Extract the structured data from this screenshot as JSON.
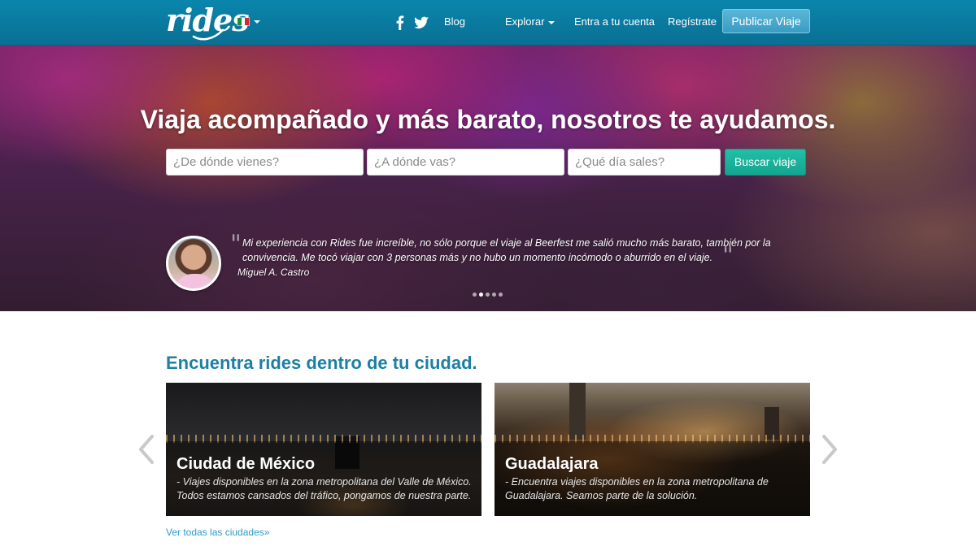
{
  "brand": {
    "logo": "rides"
  },
  "header": {
    "language_flag": "mexico-flag-icon",
    "blog_label": "Blog",
    "explore_label": "Explorar",
    "login_label": "Entra a tu cuenta",
    "register_label": "Regístrate",
    "publish_label": "Publicar Viaje",
    "social_icons": [
      "facebook-icon",
      "twitter-icon"
    ]
  },
  "hero": {
    "title": "Viaja acompañado y más barato, nosotros te ayudamos.",
    "search": {
      "from_placeholder": "¿De dónde vienes?",
      "to_placeholder": "¿A dónde vas?",
      "date_placeholder": "¿Qué día sales?",
      "button_label": "Buscar viaje"
    },
    "testimonial": {
      "quote_line1": "Mi experiencia con Rides fue increíble, no sólo porque el viaje al Beerfest me salió mucho más barato, también por la",
      "quote_line2": "convivencia. Me tocó viajar con 3 personas más y no hubo un momento incómodo o aburrido en el viaje.",
      "author": "Miguel A. Castro"
    },
    "carousel": {
      "slides": 5,
      "active": 2
    }
  },
  "cities_section": {
    "title": "Encuentra rides dentro de tu ciudad.",
    "cities": [
      {
        "name": "Ciudad de México",
        "description": "- Viajes disponibles en la zona metropolitana del Valle de México. Todos estamos cansados del tráfico, pongamos de nuestra parte."
      },
      {
        "name": "Guadalajara",
        "description": "- Encuentra viajes disponibles en la zona metropolitana de Guadalajara. Seamos parte de la solución."
      }
    ],
    "see_all_label": "Ver todas las ciudades»"
  },
  "colors": {
    "navbar": "#0a7ea3",
    "publish_button": "#4aa8cd",
    "search_button": "#1ab39b",
    "section_title": "#1d7fa3",
    "link": "#2d9ac7"
  }
}
